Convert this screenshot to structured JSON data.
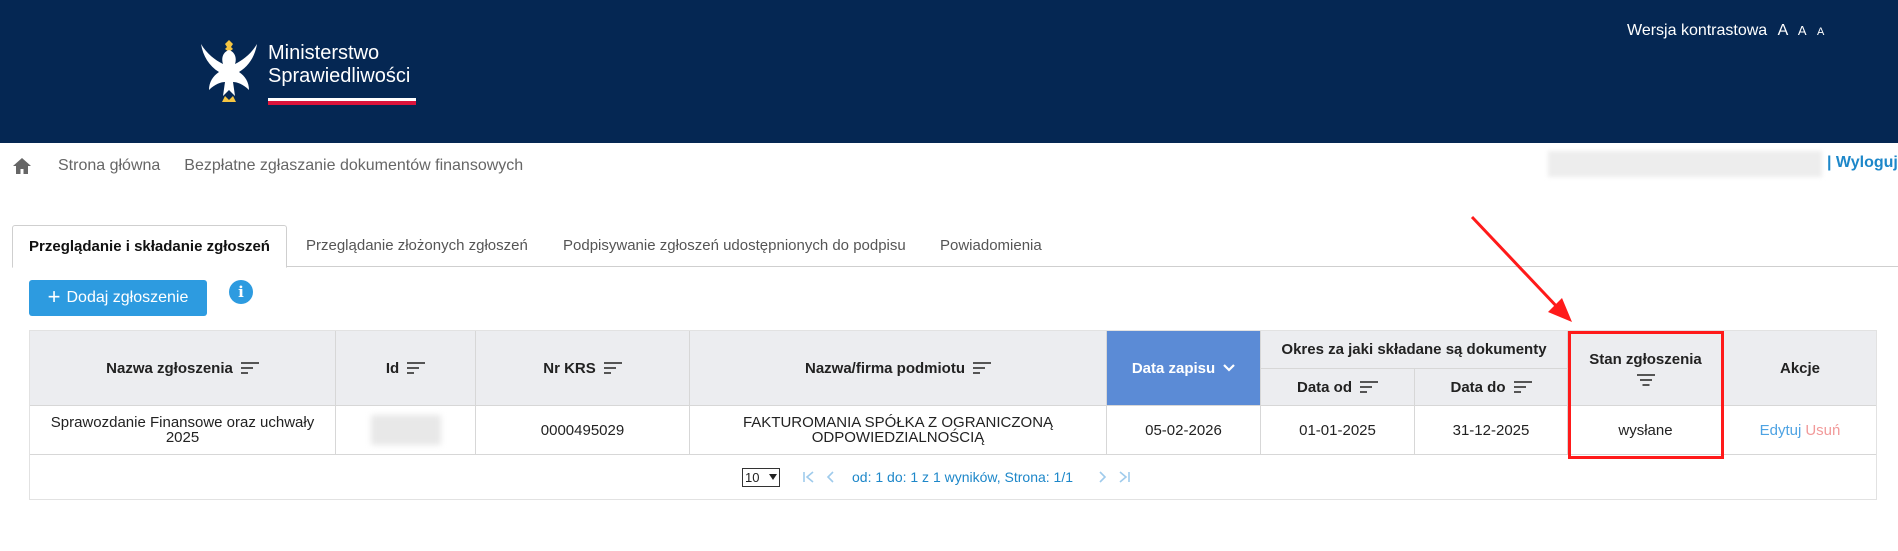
{
  "header": {
    "logo_line1": "Ministerstwo",
    "logo_line2": "Sprawiedliwości",
    "contrast_label": "Wersja kontrastowa",
    "font_size_large": "A",
    "font_size_medium": "A",
    "font_size_small": "A"
  },
  "breadcrumb": {
    "home_icon": "home-icon",
    "item1": "Strona główna",
    "item2": "Bezpłatne zgłaszanie dokumentów finansowych"
  },
  "user": {
    "logout_label": "| Wyloguj"
  },
  "tabs": [
    {
      "label": "Przeglądanie i składanie zgłoszeń",
      "active": true
    },
    {
      "label": "Przeglądanie złożonych zgłoszeń",
      "active": false
    },
    {
      "label": "Podpisywanie zgłoszeń udostępnionych do podpisu",
      "active": false
    },
    {
      "label": "Powiadomienia",
      "active": false
    }
  ],
  "toolbar": {
    "add_button_plus": "+",
    "add_button_label": "Dodaj zgłoszenie",
    "info_icon_glyph": "i"
  },
  "table": {
    "headers": {
      "name": "Nazwa zgłoszenia",
      "id": "Id",
      "krs": "Nr KRS",
      "entity": "Nazwa/firma podmiotu",
      "saved_date": "Data zapisu",
      "period_group": "Okres za jaki składane są dokumenty",
      "date_from": "Data od",
      "date_to": "Data do",
      "status": "Stan zgłoszenia",
      "actions": "Akcje"
    },
    "rows": [
      {
        "name": "Sprawozdanie Finansowe oraz uchwały 2025",
        "krs": "0000495029",
        "entity": "FAKTUROMANIA SPÓŁKA Z OGRANICZONĄ ODPOWIEDZIALNOŚCIĄ",
        "saved_date": "05-02-2026",
        "date_from": "01-01-2025",
        "date_to": "31-12-2025",
        "status": "wysłane",
        "edit": "Edytuj",
        "delete": "Usuń"
      }
    ]
  },
  "pager": {
    "page_size": "10",
    "info": "od: 1 do: 1 z 1 wyników, Strona: 1/1"
  },
  "colors": {
    "header_bg": "#052753",
    "accent": "#2d9be0",
    "sorted_header": "#5b8bd6",
    "highlight": "#ff1a1a"
  }
}
